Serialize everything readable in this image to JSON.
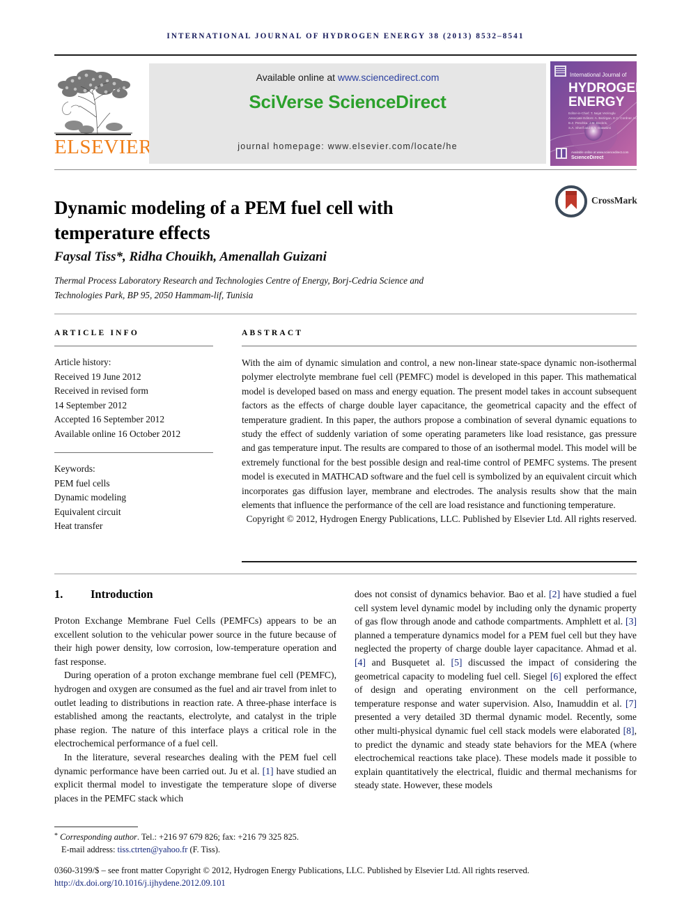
{
  "running_head": "International Journal of Hydrogen Energy 38 (2013) 8532–8541",
  "masthead": {
    "publisher": "ELSEVIER",
    "available_online": "Available online at ",
    "sciencedirect_url": "www.sciencedirect.com",
    "platform": "SciVerse ScienceDirect",
    "journal_homepage": "journal homepage: www.elsevier.com/locate/he",
    "cover": {
      "line1": "International Journal of",
      "line2": "HYDROGEN",
      "line3": "ENERGY",
      "footer": "ScienceDirect"
    }
  },
  "article": {
    "title": "Dynamic modeling of a PEM fuel cell with temperature effects",
    "crossmark_label": "CrossMark",
    "authors": "Faysal Tiss*, Ridha Chouikh, Amenallah Guizani",
    "affiliation": "Thermal Process Laboratory Research and Technologies Centre of Energy, Borj-Cedria Science and Technologies Park, BP 95, 2050 Hammam-lif, Tunisia"
  },
  "article_info": {
    "heading": "ARTICLE INFO",
    "history_label": "Article history:",
    "history": [
      "Received 19 June 2012",
      "Received in revised form",
      "14 September 2012",
      "Accepted 16 September 2012",
      "Available online 16 October 2012"
    ],
    "keywords_label": "Keywords:",
    "keywords": [
      "PEM fuel cells",
      "Dynamic modeling",
      "Equivalent circuit",
      "Heat transfer"
    ]
  },
  "abstract": {
    "heading": "ABSTRACT",
    "text": "With the aim of dynamic simulation and control, a new non-linear state-space dynamic non-isothermal polymer electrolyte membrane fuel cell (PEMFC) model is developed in this paper. This mathematical model is developed based on mass and energy equation. The present model takes in account subsequent factors as the effects of charge double layer capacitance, the geometrical capacity and the effect of temperature gradient. In this paper, the authors propose a combination of several dynamic equations to study the effect of suddenly variation of some operating parameters like load resistance, gas pressure and gas temperature input. The results are compared to those of an isothermal model. This model will be extremely functional for the best possible design and real-time control of PEMFC systems. The present model is executed in MATHCAD software and the fuel cell is symbolized by an equivalent circuit which incorporates gas diffusion layer, membrane and electrodes. The analysis results show that the main elements that influence the performance of the cell are load resistance and functioning temperature.",
    "copyright": "Copyright © 2012, Hydrogen Energy Publications, LLC. Published by Elsevier Ltd. All rights reserved."
  },
  "body": {
    "section_number": "1.",
    "section_title": "Introduction",
    "left_paragraph_1": "Proton Exchange Membrane Fuel Cells (PEMFCs) appears to be an excellent solution to the vehicular power source in the future because of their high power density, low corrosion, low-temperature operation and fast response.",
    "left_paragraph_2": "During operation of a proton exchange membrane fuel cell (PEMFC), hydrogen and oxygen are consumed as the fuel and air travel from inlet to outlet leading to distributions in reaction rate. A three-phase interface is established among the reactants, electrolyte, and catalyst in the triple phase region. The nature of this interface plays a critical role in the electrochemical performance of a fuel cell.",
    "left_paragraph_3_a": "In the literature, several researches dealing with the PEM fuel cell dynamic performance have been carried out. Ju et al. ",
    "left_ref_1": "[1]",
    "left_paragraph_3_b": " have studied an explicit thermal model to investigate the temperature slope of diverse places in the PEMFC stack which",
    "right_a": "does not consist of dynamics behavior. Bao et al. ",
    "right_ref_2": "[2]",
    "right_b": " have studied a fuel cell system level dynamic model by including only the dynamic property of gas flow through anode and cathode compartments. Amphlett et al. ",
    "right_ref_3": "[3]",
    "right_c": " planned a temperature dynamics model for a PEM fuel cell but they have neglected the property of charge double layer capacitance. Ahmad et al. ",
    "right_ref_4": "[4]",
    "right_d": " and Busquetet al. ",
    "right_ref_5": "[5]",
    "right_e": " discussed the impact of considering the geometrical capacity to modeling fuel cell. Siegel ",
    "right_ref_6": "[6]",
    "right_f": " explored the effect of design and operating environment on the cell performance, temperature response and water supervision. Also, Inamuddin et al. ",
    "right_ref_7": "[7]",
    "right_g": " presented a very detailed 3D thermal dynamic model. Recently, some other multi-physical dynamic fuel cell stack models were elaborated ",
    "right_ref_8": "[8]",
    "right_h": ", to predict the dynamic and steady state behaviors for the MEA (where electrochemical reactions take place). These models made it possible to explain quantitatively the electrical, fluidic and thermal mechanisms for steady state. However, these models"
  },
  "footnote": {
    "marker": "*",
    "corresponding": "Corresponding author",
    "contact": ". Tel.: +216 97 679 826; fax: +216 79 325 825.",
    "email_label": "E-mail address: ",
    "email": "tiss.ctrten@yahoo.fr",
    "email_suffix": " (F. Tiss)."
  },
  "footer": {
    "issn_line": "0360-3199/$ – see front matter Copyright © 2012, Hydrogen Energy Publications, LLC. Published by Elsevier Ltd. All rights reserved.",
    "doi": "http://dx.doi.org/10.1016/j.ijhydene.2012.09.101"
  },
  "colors": {
    "running_head": "#15195a",
    "elsevier_orange": "#f07f1a",
    "sciverse_green": "#2ba02b",
    "link_blue": "#13267c",
    "banner_gray": "#e6e6e6"
  }
}
